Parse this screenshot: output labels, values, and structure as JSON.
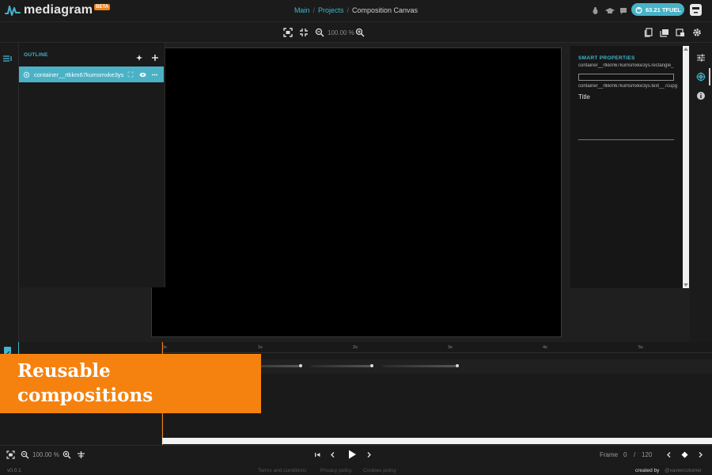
{
  "header": {
    "logo_text": "mediagram",
    "beta_label": "BETA",
    "breadcrumb": [
      "Main",
      "Projects",
      "Composition Canvas"
    ],
    "fuel_label": "63.21 TFUEL"
  },
  "toolbar": {
    "zoom_text": "100.00 %"
  },
  "outline": {
    "title": "OUTLINE",
    "items": [
      {
        "label": "container__rtkkm67kumsmxke3ys"
      }
    ]
  },
  "smart_properties": {
    "title": "SMART PROPERTIES",
    "rows": [
      "container__rtkkm67kumsmxke3ys.rectangle_",
      "container__rtkkm67kumsmxke3ys.text__7cupg"
    ],
    "input_value": "",
    "title_value": "Title"
  },
  "timeline": {
    "ticks": [
      "0s",
      "1s",
      "2s",
      "3s",
      "4s",
      "5s"
    ]
  },
  "bottombar": {
    "zoom_text": "100.00 %",
    "frame_label": "Frame",
    "frame_current": "0",
    "frame_sep": "/",
    "frame_total": "120"
  },
  "footer": {
    "version": "v0.0.1",
    "links": [
      "Terms and conditions",
      "Privacy policy",
      "Cookies policy"
    ],
    "created_by": "created by",
    "author": "@xaviercolomer"
  },
  "promo": {
    "line1": "Reusable",
    "line2": "compositions"
  },
  "colors": {
    "accent": "#47b3c8",
    "promo": "#f5820e"
  }
}
